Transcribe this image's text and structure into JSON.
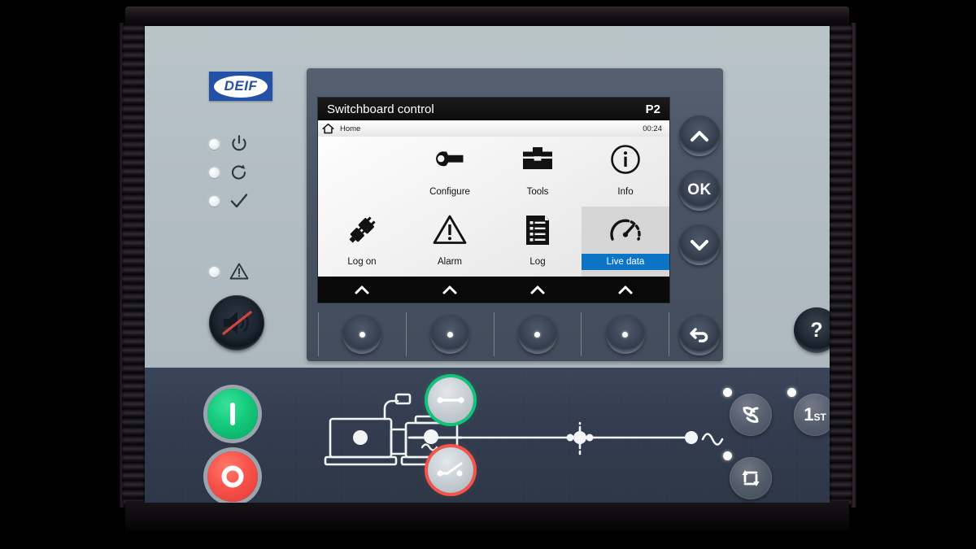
{
  "device": {
    "brand": "DEIF",
    "panel_name": "switchboard-controller-front-panel"
  },
  "status_leds": [
    {
      "name": "power-led",
      "icon": "power-icon",
      "state": "off"
    },
    {
      "name": "running-led",
      "icon": "refresh-icon",
      "state": "off"
    },
    {
      "name": "ok-led",
      "icon": "checkmark-icon",
      "state": "off"
    },
    {
      "name": "alarm-led",
      "icon": "warning-triangle-icon",
      "state": "off"
    }
  ],
  "horn_button": {
    "label": "horn-silence-button",
    "icon": "speaker-muted-icon",
    "slash_color": "#d6453b"
  },
  "display": {
    "title": "Switchboard control",
    "page_id": "P2",
    "breadcrumb": "Home",
    "breadcrumb_icon": "home-icon",
    "time": "00:24",
    "selected_item": "Live data",
    "selection_color": "#0b74c4",
    "menu": [
      {
        "label": "Configure",
        "icon": "wrench-icon",
        "selected": false
      },
      {
        "label": "Tools",
        "icon": "toolbox-icon",
        "selected": false
      },
      {
        "label": "Info",
        "icon": "info-icon",
        "selected": false
      },
      {
        "label": "Log on",
        "icon": "plug-icon",
        "selected": false
      },
      {
        "label": "Alarm",
        "icon": "warning-triangle-icon",
        "selected": false
      },
      {
        "label": "Log",
        "icon": "document-list-icon",
        "selected": false
      },
      {
        "label": "Live data",
        "icon": "gauge-icon",
        "selected": true
      }
    ],
    "softkey_hints": [
      "chevron-up-icon",
      "chevron-up-icon",
      "chevron-up-icon",
      "chevron-up-icon"
    ]
  },
  "softkeys": [
    {
      "name": "softkey-1"
    },
    {
      "name": "softkey-2"
    },
    {
      "name": "softkey-3"
    },
    {
      "name": "softkey-4"
    }
  ],
  "navigation": {
    "up": {
      "label": "",
      "icon": "chevron-up-icon"
    },
    "ok": {
      "label": "OK",
      "icon": ""
    },
    "down": {
      "label": "",
      "icon": "chevron-down-icon"
    },
    "back": {
      "label": "",
      "icon": "back-arrow-icon"
    },
    "help": {
      "label": "?",
      "icon": "question-mark-icon"
    }
  },
  "controls": {
    "start_button": {
      "name": "start-button",
      "symbol": "I",
      "color": "#15c97c"
    },
    "stop_button": {
      "name": "stop-button",
      "symbol": "O",
      "color": "#f8534a"
    },
    "breaker_generator": {
      "name": "generator-breaker-button",
      "state": "closed",
      "color": "#14c37a"
    },
    "breaker_mains": {
      "name": "mains-breaker-button",
      "state": "open",
      "color": "#f4554a"
    }
  },
  "mimic": {
    "engine_icon": "diesel-engine-icon",
    "alternator_icon": "alternator-icon",
    "alternator_symbol": "~",
    "mains_icon": "ac-mains-icon",
    "busbar": "busbar-line"
  },
  "mode_buttons": [
    {
      "name": "semi-auto-mode-button",
      "icon": "swirl-icon",
      "label": "",
      "led": "on"
    },
    {
      "name": "first-priority-button",
      "icon": "",
      "label": "1ST",
      "led": "on"
    },
    {
      "name": "cyclic-mode-button",
      "icon": "cycle-arrows-icon",
      "label": "",
      "led": "on"
    }
  ]
}
